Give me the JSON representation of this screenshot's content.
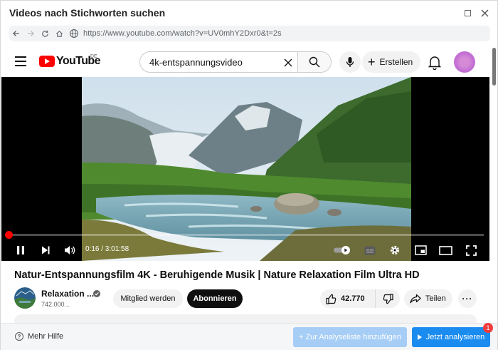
{
  "window": {
    "title": "Videos nach Stichworten suchen"
  },
  "browser": {
    "url": "https://www.youtube.com/watch?v=UV0mhY2Dxr0&t=2s"
  },
  "youtube": {
    "logo_text": "YouTube",
    "region": "DE",
    "search_query": "4k-entspannungsvideo",
    "create_label": "Erstellen"
  },
  "player": {
    "time": "0:16 / 3:01:58",
    "progress_fraction": 0.0015
  },
  "video": {
    "title": "Natur-Entspannungsfilm 4K - Beruhigende Musik | Nature Relaxation Film Ultra HD",
    "channel_name": "Relaxation ...",
    "subscribers": "742.000...",
    "member_label": "Mitglied werden",
    "subscribe_label": "Abonnieren",
    "likes": "42.770",
    "share_label": "Teilen",
    "more_label": "···"
  },
  "footer": {
    "help_label": "Mehr Hilfe",
    "add_list_label": "+ Zur Analyseliste hinzufügen",
    "analyze_label": "Jetzt analysieren",
    "badge_count": "1"
  },
  "colors": {
    "youtube_red": "#ff0000",
    "primary_blue": "#1a8cf0",
    "disabled_blue": "#a6cdf5",
    "badge_red": "#f03c3c"
  }
}
